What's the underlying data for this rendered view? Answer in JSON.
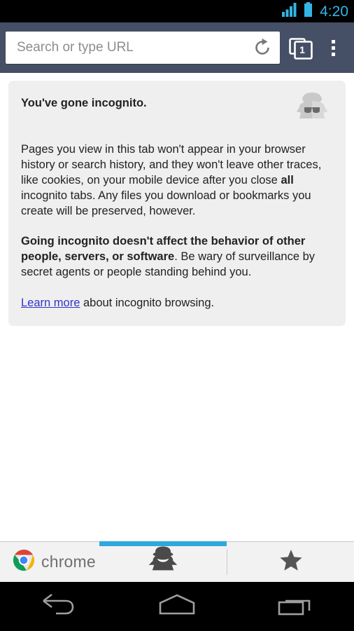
{
  "status_bar": {
    "time": "4:20",
    "signal_icon": "signal-bars-icon",
    "battery_icon": "battery-full-icon",
    "accent_color": "#33B5E5",
    "background_color": "#000000"
  },
  "toolbar": {
    "background_color": "#454F66",
    "omnibox_placeholder": "Search or type URL",
    "omnibox_value": "",
    "reload_icon": "reload-icon",
    "tab_switcher_icon": "tab-stack-icon",
    "tab_count": "1",
    "menu_icon": "overflow-menu-icon"
  },
  "page": {
    "background_color": "#ffffff",
    "card": {
      "background_color": "#EFEFEF",
      "icon": "incognito-spy-icon",
      "title": "You've gone incognito.",
      "paragraph1": {
        "part1": "Pages you view in this tab won't appear in your browser history or search history, and they won't leave other traces, like cookies, on your mobile device after you close ",
        "bold": "all",
        "part2": " incognito tabs. Any files you download or bookmarks you create will be preserved, however."
      },
      "paragraph2": {
        "bold": "Going incognito doesn't affect the behavior of other people, servers, or software",
        "rest": ". Be wary of surveillance by secret agents or people standing behind you."
      },
      "link_text": "Learn more",
      "link_suffix": " about incognito browsing.",
      "link_color": "#3333cc"
    }
  },
  "bottom_bar": {
    "background_color": "#F2F2F2",
    "active_indicator_color": "#2FA8DB",
    "tabs": [
      {
        "label": "chrome",
        "icon": "chrome-logo-icon",
        "active": false
      },
      {
        "label": "",
        "icon": "incognito-spy-icon",
        "active": true
      },
      {
        "label": "",
        "icon": "star-icon",
        "active": false
      }
    ]
  },
  "nav_bar": {
    "background_color": "#000000",
    "buttons": [
      {
        "icon": "back-arrow-icon"
      },
      {
        "icon": "home-icon"
      },
      {
        "icon": "recents-icon"
      }
    ]
  }
}
